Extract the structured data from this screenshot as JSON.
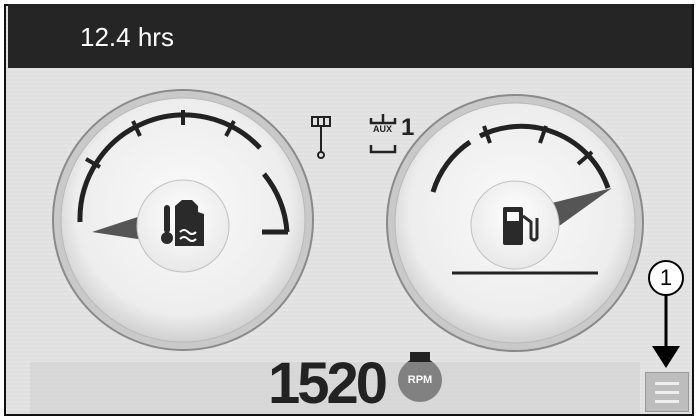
{
  "status": {
    "hours": "12.4 hrs"
  },
  "gauges": {
    "left": {
      "name": "coolant-temperature",
      "icon": "coolant-temperature-icon",
      "level": 0.08
    },
    "right": {
      "name": "fuel-level",
      "icon": "fuel-pump-icon",
      "level": 0.9
    }
  },
  "indicators": {
    "trim_icon": "trim-position-icon",
    "aux_icon": "aux-input-icon",
    "aux_label": "AUX",
    "aux_number": "1"
  },
  "engine": {
    "rpm": "1520",
    "rpm_unit": "RPM"
  },
  "callout": {
    "number": "1"
  },
  "menu": {
    "icon": "menu-icon"
  }
}
